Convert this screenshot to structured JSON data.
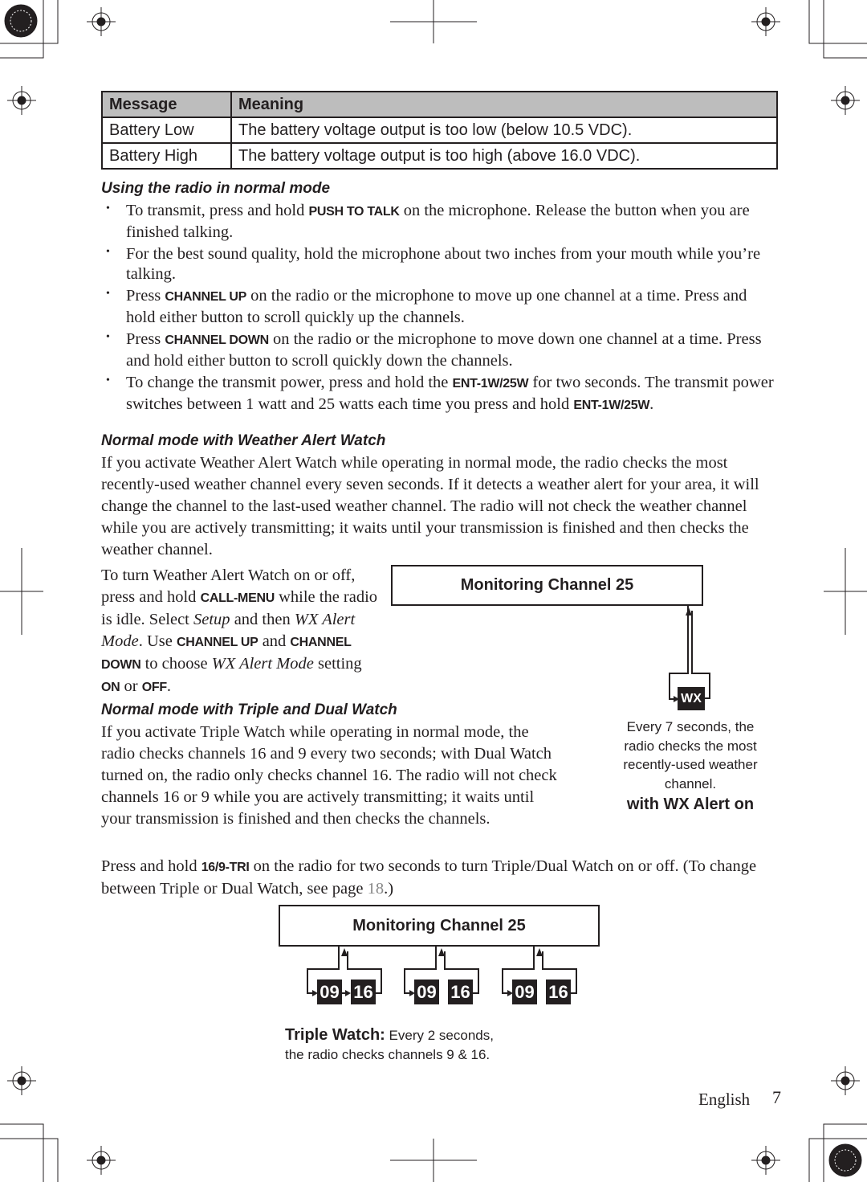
{
  "table": {
    "headers": [
      "Message",
      "Meaning"
    ],
    "rows": [
      [
        "Battery Low",
        "The battery voltage output is too low (below 10.5 VDC)."
      ],
      [
        "Battery High",
        "The battery voltage output is too high (above 16.0 VDC)."
      ]
    ]
  },
  "section1": {
    "heading": "Using the radio in normal mode",
    "bullets": [
      [
        {
          "t": "To transmit, press and hold "
        },
        {
          "k": "PUSH TO TALK"
        },
        {
          "t": " on the microphone. Release the button when you are finished talking."
        }
      ],
      [
        {
          "t": "For the best sound quality, hold the microphone about two inches from your mouth while you’re talking."
        }
      ],
      [
        {
          "t": "Press "
        },
        {
          "k": "CHANNEL UP"
        },
        {
          "t": " on the radio or the microphone to move up one channel at a time. Press and hold either button to scroll quickly up the channels."
        }
      ],
      [
        {
          "t": "Press "
        },
        {
          "k": "CHANNEL DOWN"
        },
        {
          "t": " on the radio or the microphone to move down one channel at a time. Press and hold either button to scroll quickly down the channels."
        }
      ],
      [
        {
          "t": "To change the transmit power, press and hold the "
        },
        {
          "k": "ENT-1W/25W"
        },
        {
          "t": " for two seconds. The transmit power switches between 1 watt and 25 watts each time you press and hold "
        },
        {
          "k": "ENT-1W/25W"
        },
        {
          "t": "."
        }
      ]
    ]
  },
  "section2": {
    "heading": "Normal mode with Weather Alert Watch",
    "paragraph": [
      {
        "t": "If you activate Weather Alert Watch while operating in normal mode, the radio checks the most recently-used weather channel every seven seconds. If it detects a weather alert for your area, it will change the channel to the last-used weather channel. The radio will not check the weather channel while you are actively transmitting; it waits until your transmission is finished and then checks the weather channel."
      }
    ],
    "paragraph2": [
      {
        "t": "To turn Weather Alert Watch on or off, press and hold "
      },
      {
        "k": "CALL-MENU"
      },
      {
        "t": " while the radio is idle. Select "
      },
      {
        "i": "Setup"
      },
      {
        "t": " and then "
      },
      {
        "i": "WX Alert Mode"
      },
      {
        "t": ". Use "
      },
      {
        "k": "CHANNEL UP"
      },
      {
        "t": " and "
      },
      {
        "k": "CHANNEL DOWN"
      },
      {
        "t": " to choose "
      },
      {
        "i": "WX Alert Mode"
      },
      {
        "t": " setting "
      },
      {
        "k": "ON"
      },
      {
        "t": " or "
      },
      {
        "k": "OFF"
      },
      {
        "t": "."
      }
    ],
    "diagram": {
      "box_label": "Monitoring Channel 25",
      "channel": "WX",
      "caption": "Every 7 seconds, the radio checks the most recently-used weather channel.",
      "caption_bold": "with WX Alert on"
    }
  },
  "section3": {
    "heading": "Normal mode with Triple and Dual Watch",
    "paragraph": [
      {
        "t": "If you activate Triple Watch while operating in normal mode, the radio checks channels 16 and 9 every two seconds; with Dual Watch turned on, the radio only checks channel 16. The radio will not check channels 16 or 9 while you are actively transmitting; it waits until your transmission is finished and then checks the channels."
      }
    ],
    "paragraph2": [
      {
        "t": "Press and hold "
      },
      {
        "k": "16/9-TRI"
      },
      {
        "t": " on the radio for two seconds to turn Triple/Dual Watch on or off. (To change between Triple or Dual Watch, see page "
      },
      {
        "p": "18"
      },
      {
        "t": ".)"
      }
    ],
    "diagram": {
      "box_label": "Monitoring Channel 25",
      "channels": [
        "09",
        "16",
        "09",
        "16",
        "09",
        "16"
      ],
      "caption_bold": "Triple Watch:",
      "caption": " Every 2 seconds,",
      "caption2": "the radio checks channels 9 & 16."
    }
  },
  "footer": {
    "language": "English",
    "page_number": "7"
  }
}
